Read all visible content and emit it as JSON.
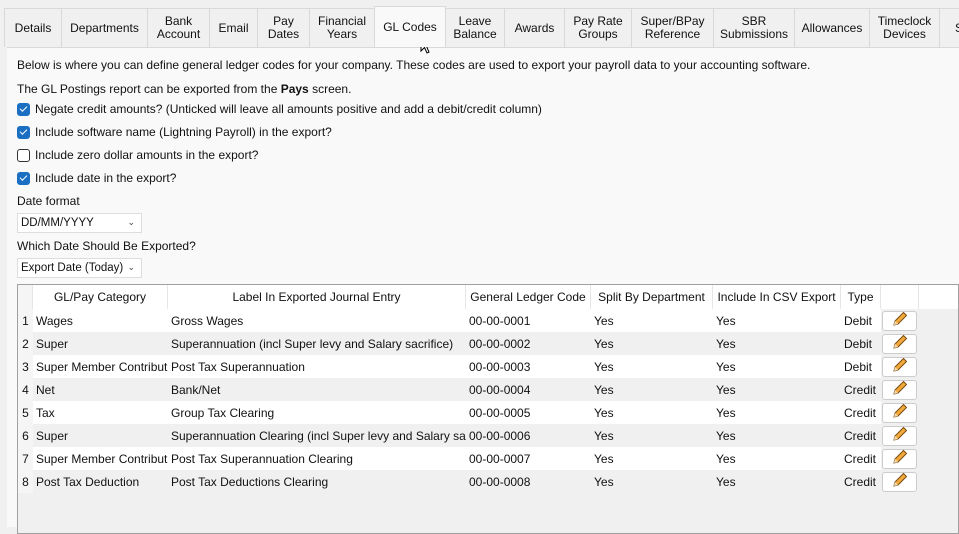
{
  "tabs": [
    {
      "label": "Details",
      "w": 58
    },
    {
      "label": "Departments",
      "w": 87
    },
    {
      "label": "Bank Account",
      "w": 63
    },
    {
      "label": "Email",
      "w": 49
    },
    {
      "label": "Pay Dates",
      "w": 53
    },
    {
      "label": "Financial Years",
      "w": 66
    },
    {
      "label": "GL Codes",
      "w": 72,
      "active": true
    },
    {
      "label": "Leave Balance",
      "w": 60
    },
    {
      "label": "Awards",
      "w": 61
    },
    {
      "label": "Pay Rate Groups",
      "w": 68
    },
    {
      "label": "Super/BPay Reference",
      "w": 83
    },
    {
      "label": "SBR Submissions",
      "w": 82
    },
    {
      "label": "Allowances",
      "w": 76
    },
    {
      "label": "Timeclock Devices",
      "w": 71
    },
    {
      "label": "S",
      "w": 40
    }
  ],
  "intro": "Below is where you can define general ledger codes for your company. These codes are used to export your payroll data to your accounting software.",
  "report_note": {
    "pre": "The GL Postings report can be exported from the ",
    "bold": "Pays",
    "post": " screen."
  },
  "options": [
    {
      "label": "Negate credit amounts? (Unticked will leave all amounts positive and add a debit/credit column)",
      "checked": true
    },
    {
      "label": "Include software name (Lightning Payroll) in the export?",
      "checked": true
    },
    {
      "label": "Include zero dollar amounts in the export?",
      "checked": false
    },
    {
      "label": "Include date in the export?",
      "checked": true
    }
  ],
  "date_format": {
    "label": "Date format",
    "value": "DD/MM/YYYY"
  },
  "date_export": {
    "label": "Which Date Should Be Exported?",
    "value": "Export Date (Today)"
  },
  "table": {
    "headers": [
      "GL/Pay Category",
      "Label In Exported Journal Entry",
      "General Ledger Code",
      "Split By Department",
      "Include In CSV Export",
      "Type"
    ],
    "rows": [
      [
        "1",
        "Wages",
        "Gross Wages",
        "00-00-0001",
        "Yes",
        "Yes",
        "Debit"
      ],
      [
        "2",
        "Super",
        "Superannuation (incl Super levy and Salary sacrifice)",
        "00-00-0002",
        "Yes",
        "Yes",
        "Debit"
      ],
      [
        "3",
        "Super Member Contribution",
        "Post Tax Superannuation",
        "00-00-0003",
        "Yes",
        "Yes",
        "Debit"
      ],
      [
        "4",
        "Net",
        "Bank/Net",
        "00-00-0004",
        "Yes",
        "Yes",
        "Credit"
      ],
      [
        "5",
        "Tax",
        "Group Tax Clearing",
        "00-00-0005",
        "Yes",
        "Yes",
        "Credit"
      ],
      [
        "6",
        "Super",
        "Superannuation Clearing (incl Super levy and Salary sacrifice)",
        "00-00-0006",
        "Yes",
        "Yes",
        "Credit"
      ],
      [
        "7",
        "Super Member Contribution",
        "Post Tax Superannuation Clearing",
        "00-00-0007",
        "Yes",
        "Yes",
        "Credit"
      ],
      [
        "8",
        "Post Tax Deduction",
        "Post Tax Deductions Clearing",
        "00-00-0008",
        "Yes",
        "Yes",
        "Credit"
      ]
    ]
  }
}
